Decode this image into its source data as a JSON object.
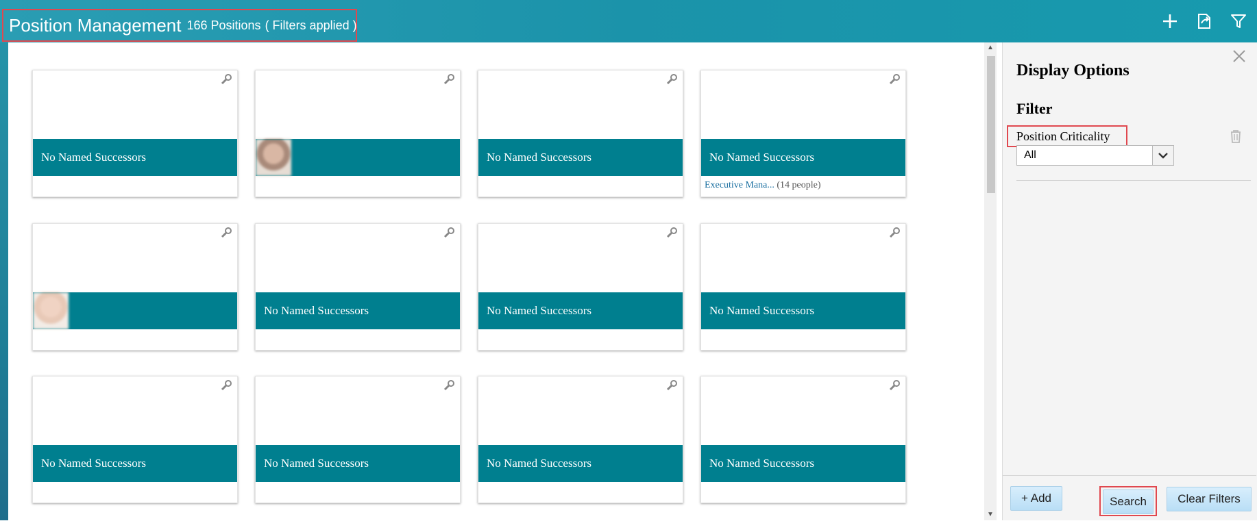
{
  "header": {
    "title": "Position Management",
    "count": "166 Positions",
    "filter_status": "( Filters applied )",
    "icons": [
      "add-icon",
      "export-icon",
      "filter-icon"
    ],
    "bg_color": "#1b93aa"
  },
  "tiles": [
    {
      "title": "",
      "subtitle": "",
      "band": "No Named Successors",
      "footer_link": "",
      "footer_people": "",
      "photo": false
    },
    {
      "title": "",
      "subtitle": "",
      "band": "",
      "footer_link": "",
      "footer_people": "",
      "photo": true
    },
    {
      "title": "",
      "subtitle": "",
      "band": "No Named Successors",
      "footer_link": "",
      "footer_people": "",
      "photo": false
    },
    {
      "title": "",
      "subtitle": "",
      "band": "No Named Successors",
      "footer_link": "Executive Mana...",
      "footer_people": "(14 people)",
      "photo": false
    },
    {
      "title": "",
      "subtitle": "",
      "band": "",
      "footer_link": "",
      "footer_people": "",
      "photo": true
    },
    {
      "title": "",
      "subtitle": "",
      "band": "No Named Successors",
      "footer_link": "",
      "footer_people": "",
      "photo": false
    },
    {
      "title": "",
      "subtitle": "",
      "band": "No Named Successors",
      "footer_link": "",
      "footer_people": "",
      "photo": false
    },
    {
      "title": "",
      "subtitle": "",
      "band": "No Named Successors",
      "footer_link": "",
      "footer_people": "",
      "photo": false
    },
    {
      "title": "",
      "subtitle": "",
      "band": "No Named Successors",
      "footer_link": "",
      "footer_people": "",
      "photo": false
    },
    {
      "title": "",
      "subtitle": "",
      "band": "No Named Successors",
      "footer_link": "",
      "footer_people": "",
      "photo": false
    },
    {
      "title": "",
      "subtitle": "",
      "band": "No Named Successors",
      "footer_link": "",
      "footer_people": "",
      "photo": false
    },
    {
      "title": "",
      "subtitle": "",
      "band": "No Named Successors",
      "footer_link": "",
      "footer_people": "",
      "photo": false
    }
  ],
  "panel": {
    "title": "Display Options",
    "filter_heading": "Filter",
    "filter_field_label": "Position Criticality",
    "filter_value": "All",
    "buttons": {
      "add": "+ Add",
      "search": "Search",
      "clear": "Clear Filters"
    }
  },
  "colors": {
    "accent_band": "#007f8f",
    "highlight_border": "#e0484f",
    "button_bg": "#c8e6fa"
  }
}
